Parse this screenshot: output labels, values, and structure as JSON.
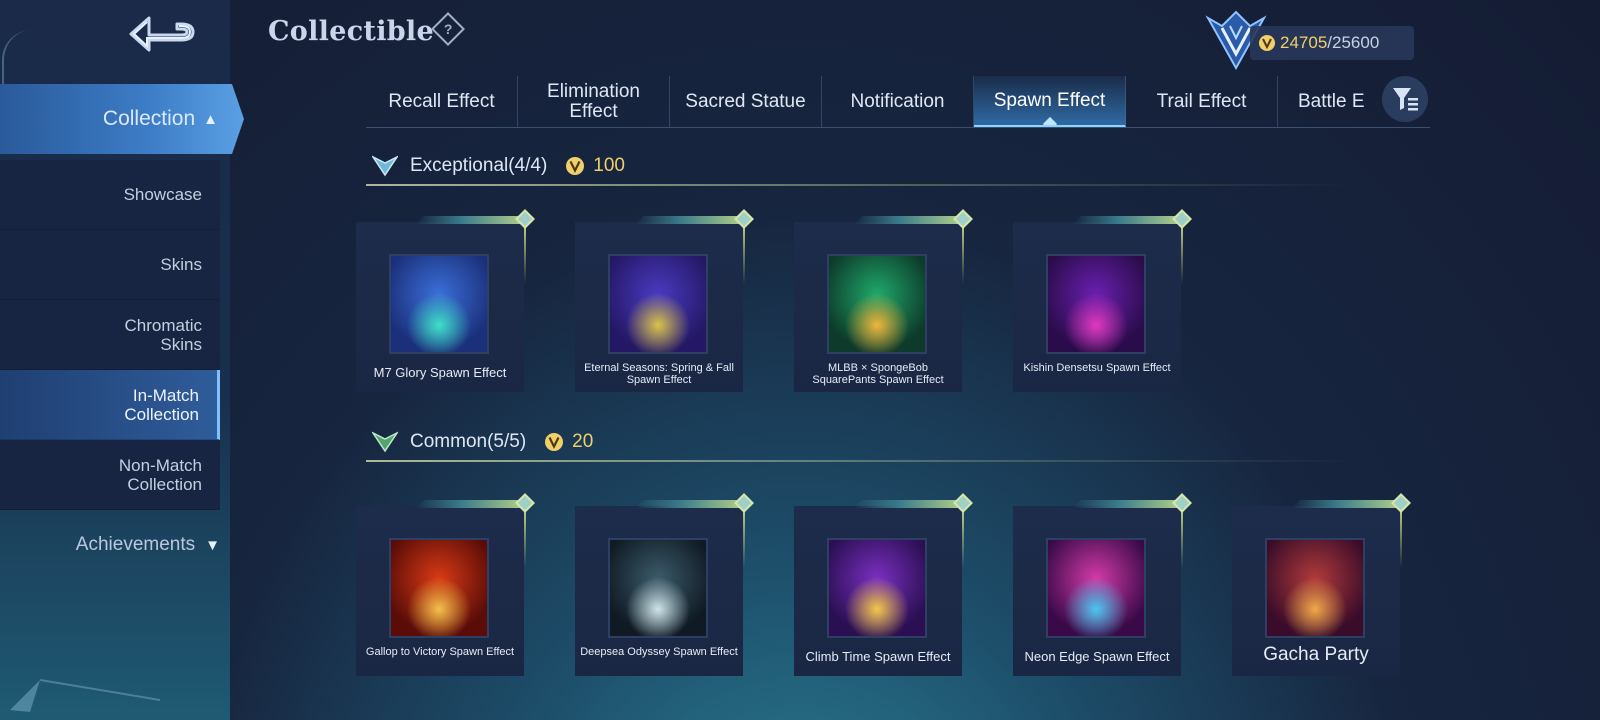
{
  "header": {
    "title": "Collectible",
    "help": "?"
  },
  "currency": {
    "have": "24705",
    "separator": "/",
    "max": "25600"
  },
  "sidebar": {
    "collection_label": "Collection",
    "items": [
      {
        "label": "Showcase",
        "active": false
      },
      {
        "label": "Skins",
        "active": false
      },
      {
        "label": "Chromatic\nSkins",
        "active": false
      },
      {
        "label": "In-Match\nCollection",
        "active": true
      },
      {
        "label": "Non-Match\nCollection",
        "active": false
      }
    ],
    "achievements_label": "Achievements"
  },
  "tabs": [
    {
      "label": "Recall Effect"
    },
    {
      "label": "Elimination\nEffect"
    },
    {
      "label": "Sacred Statue"
    },
    {
      "label": "Notification"
    },
    {
      "label": "Spawn Effect",
      "active": true
    },
    {
      "label": "Trail Effect"
    },
    {
      "label": "Battle E"
    }
  ],
  "sections": [
    {
      "name": "Exceptional(4/4)",
      "price": "100",
      "items": [
        {
          "name": "M7 Glory Spawn Effect",
          "icon": "m7-glory-icon",
          "colors": [
            "#1b2f7a",
            "#3a6fd8",
            "#3fe0c8"
          ]
        },
        {
          "name": "Eternal Seasons: Spring & Fall Spawn Effect",
          "icon": "eternal-seasons-icon",
          "colors": [
            "#241866",
            "#4a3ac0",
            "#d9c24a"
          ]
        },
        {
          "name": "MLBB × SpongeBob SquarePants Spawn Effect",
          "icon": "spongebob-icon",
          "colors": [
            "#0d3a2a",
            "#1fa86a",
            "#f0b43a"
          ]
        },
        {
          "name": "Kishin Densetsu Spawn Effect",
          "icon": "kishin-densetsu-icon",
          "colors": [
            "#2a0c4a",
            "#6a1fb0",
            "#e03ac0"
          ]
        }
      ]
    },
    {
      "name": "Common(5/5)",
      "price": "20",
      "items": [
        {
          "name": "Gallop to Victory Spawn Effect",
          "icon": "gallop-to-victory-icon",
          "colors": [
            "#5a0c08",
            "#d83a14",
            "#f5c04a"
          ]
        },
        {
          "name": "Deepsea Odyssey Spawn Effect",
          "icon": "deepsea-odyssey-icon",
          "colors": [
            "#0f1a24",
            "#3b5a6a",
            "#cfe4ea"
          ]
        },
        {
          "name": "Climb Time Spawn Effect",
          "icon": "climb-time-icon",
          "colors": [
            "#2a0f52",
            "#7a2fc0",
            "#f5c84a"
          ]
        },
        {
          "name": "Neon Edge Spawn Effect",
          "icon": "neon-edge-icon",
          "colors": [
            "#3a0a48",
            "#d23aa8",
            "#4ac8f0"
          ]
        },
        {
          "name": "Gacha Party",
          "icon": "gacha-party-icon",
          "colors": [
            "#3a0c2a",
            "#b03a3a",
            "#f0a84a"
          ]
        }
      ]
    }
  ],
  "colors": {
    "accent": "#3c7cc6",
    "gold": "#f1cf6a",
    "frame": "#b8d58a"
  }
}
